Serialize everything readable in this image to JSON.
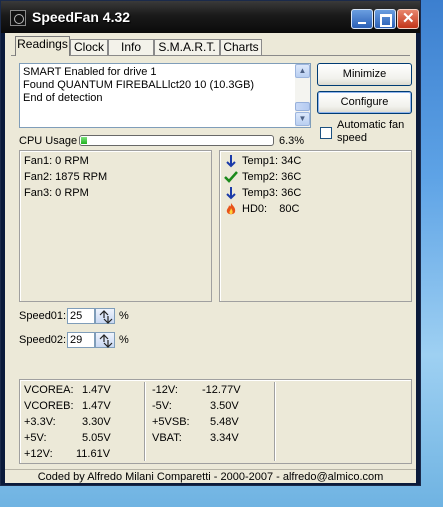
{
  "window": {
    "title": "SpeedFan 4.32"
  },
  "tabs": [
    {
      "label": "Readings"
    },
    {
      "label": "Clock"
    },
    {
      "label": "Info"
    },
    {
      "label": "S.M.A.R.T."
    },
    {
      "label": "Charts"
    }
  ],
  "log": {
    "lines": [
      "SMART Enabled for drive 1",
      "Found QUANTUM FIREBALLlct20 10 (10.3GB)",
      "End of detection"
    ]
  },
  "buttons": {
    "minimize": "Minimize",
    "configure": "Configure"
  },
  "auto_fan": {
    "label": "Automatic fan speed",
    "checked": false
  },
  "cpu": {
    "label": "CPU Usage",
    "value": "6.3%",
    "percent": 6.3
  },
  "fans": [
    {
      "text": "Fan1: 0 RPM"
    },
    {
      "text": "Fan2: 1875 RPM"
    },
    {
      "text": "Fan3: 0 RPM"
    }
  ],
  "temps": [
    {
      "text": "Temp1: 34C",
      "icon": "arrow-down-icon"
    },
    {
      "text": "Temp2: 36C",
      "icon": "checkmark-icon"
    },
    {
      "text": "Temp3: 36C",
      "icon": "arrow-down-icon"
    },
    {
      "text": "HD0:    80C",
      "icon": "flame-icon"
    }
  ],
  "speeds": [
    {
      "label": "Speed01:",
      "value": "25",
      "unit": "%"
    },
    {
      "label": "Speed02:",
      "value": "29",
      "unit": "%"
    }
  ],
  "voltages": {
    "left": [
      {
        "name": "VCOREA:",
        "value": "1.47V"
      },
      {
        "name": "VCOREB:",
        "value": "1.47V"
      },
      {
        "name": "+3.3V:",
        "value": "3.30V"
      },
      {
        "name": "+5V:",
        "value": "5.05V"
      },
      {
        "name": "+12V:",
        "value": "11.61V"
      }
    ],
    "right": [
      {
        "name": "-12V:",
        "value": "-12.77V"
      },
      {
        "name": "-5V:",
        "value": "3.50V"
      },
      {
        "name": "+5VSB:",
        "value": "5.48V"
      },
      {
        "name": "VBAT:",
        "value": "3.34V"
      }
    ]
  },
  "status": {
    "text": "Coded by Alfredo Milani Comparetti - 2000-2007 - alfredo@almico.com"
  },
  "colors": {
    "accent": "#2a5fb6",
    "window_bg": "#ece9d8",
    "cpu_bar": "#1fb21f"
  }
}
